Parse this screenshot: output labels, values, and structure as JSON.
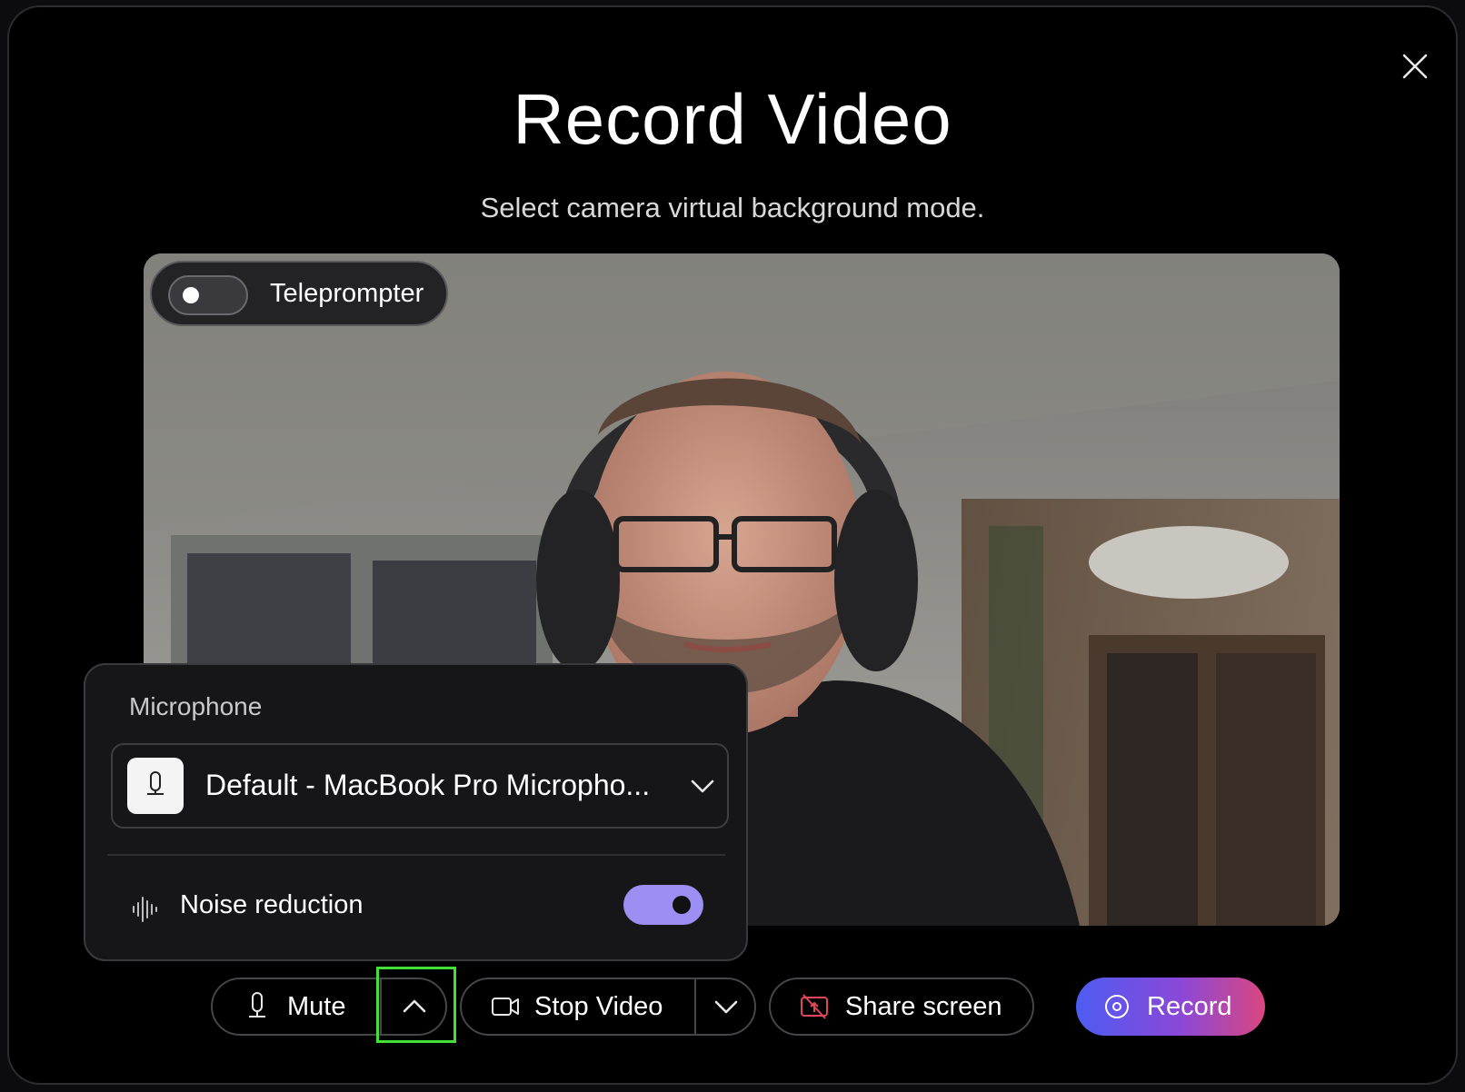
{
  "dialog": {
    "title": "Record Video",
    "subtitle": "Select camera virtual background mode."
  },
  "video": {
    "teleprompter_label": "Teleprompter",
    "teleprompter_on": false
  },
  "microphone_panel": {
    "heading": "Microphone",
    "selected_device": "Default - MacBook Pro Micropho...",
    "noise_reduction_label": "Noise reduction",
    "noise_reduction_on": true
  },
  "controls": {
    "mute_label": "Mute",
    "stop_video_label": "Stop Video",
    "share_screen_label": "Share screen",
    "record_label": "Record"
  },
  "colors": {
    "toggle_on": "#9c8ef2",
    "share_icon": "#e0485a",
    "record_gradient_start": "#4d5cf2",
    "record_gradient_end": "#d9477f",
    "highlight_box": "#44e03a"
  }
}
